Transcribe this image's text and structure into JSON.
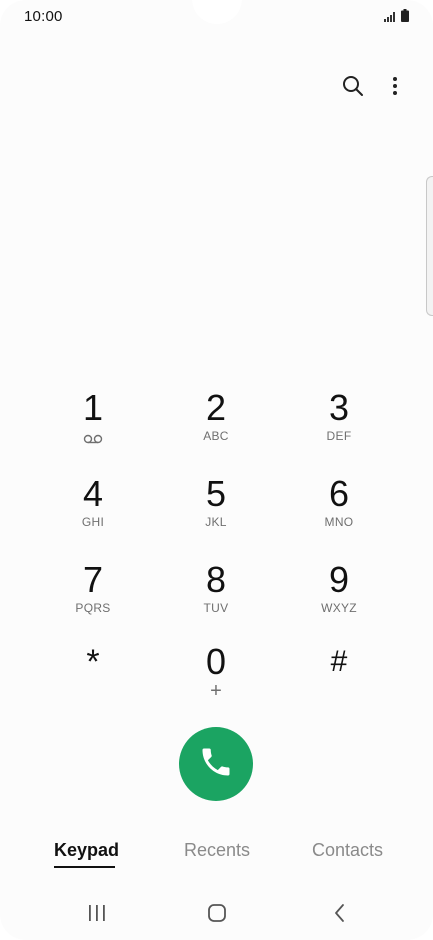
{
  "status_bar": {
    "time": "10:00"
  },
  "top_actions": {
    "search_icon": "search-icon",
    "more_icon": "more-options-icon"
  },
  "keypad": {
    "keys": [
      {
        "digit": "1",
        "letters": ""
      },
      {
        "digit": "2",
        "letters": "ABC"
      },
      {
        "digit": "3",
        "letters": "DEF"
      },
      {
        "digit": "4",
        "letters": "GHI"
      },
      {
        "digit": "5",
        "letters": "JKL"
      },
      {
        "digit": "6",
        "letters": "MNO"
      },
      {
        "digit": "7",
        "letters": "PQRS"
      },
      {
        "digit": "8",
        "letters": "TUV"
      },
      {
        "digit": "9",
        "letters": "WXYZ"
      },
      {
        "digit": "*",
        "letters": ""
      },
      {
        "digit": "0",
        "letters": "+"
      },
      {
        "digit": "#",
        "letters": ""
      }
    ]
  },
  "call": {
    "color": "#1ba462",
    "icon": "phone-icon"
  },
  "tabs": [
    {
      "label": "Keypad",
      "active": true
    },
    {
      "label": "Recents",
      "active": false
    },
    {
      "label": "Contacts",
      "active": false
    }
  ],
  "navbar": {
    "recent_icon": "recent-apps-icon",
    "home_icon": "home-icon",
    "back_icon": "back-icon"
  }
}
